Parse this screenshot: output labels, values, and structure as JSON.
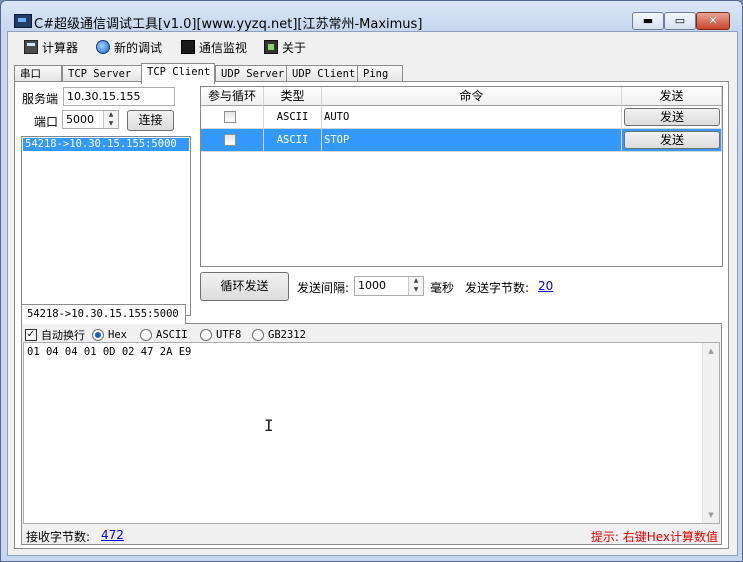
{
  "window": {
    "title": "C#超级通信调试工具[v1.0][www.yyzq.net][江苏常州-Maximus]",
    "minimize_label": "▬",
    "maximize_label": "▭",
    "close_label": "✕"
  },
  "menu": {
    "items": [
      {
        "label": "计算器",
        "icon": "calculator-icon"
      },
      {
        "label": "新的调试",
        "icon": "globe-icon"
      },
      {
        "label": "通信监视",
        "icon": "monitor-icon"
      },
      {
        "label": "关于",
        "icon": "about-icon"
      }
    ]
  },
  "tabs": [
    {
      "label": "串口"
    },
    {
      "label": "TCP Server"
    },
    {
      "label": "TCP Client",
      "active": true
    },
    {
      "label": "UDP Server"
    },
    {
      "label": "UDP Client"
    },
    {
      "label": "Ping"
    }
  ],
  "connection": {
    "server_label": "服务端",
    "server_value": "10.30.15.155",
    "port_label": "端口",
    "port_value": "5000",
    "connect_button": "连接",
    "connections": [
      "54218->10.30.15.155:5000"
    ]
  },
  "commands": {
    "headers": [
      "参与循环",
      "类型",
      "命令",
      "发送"
    ],
    "rows": [
      {
        "loop": false,
        "type": "ASCII",
        "command": "AUTO",
        "send": "发送",
        "selected": false
      },
      {
        "loop": false,
        "type": "ASCII",
        "command": "STOP",
        "send": "发送",
        "selected": true
      }
    ]
  },
  "send_controls": {
    "loop_button": "循环发送",
    "interval_label": "发送间隔:",
    "interval_value": "1000",
    "interval_unit": "毫秒",
    "bytes_label": "发送字节数:",
    "bytes_value": "20"
  },
  "receive": {
    "tab_label": "54218->10.30.15.155:5000",
    "auto_wrap_label": "自动换行",
    "auto_wrap_checked": true,
    "formats": [
      "Hex",
      "ASCII",
      "UTF8",
      "GB2312"
    ],
    "selected_format": "Hex",
    "content": "01 04 04 01 0D 02 47 2A E9",
    "bytes_label": "接收字节数:",
    "bytes_value": "472",
    "hint": "提示: 右键Hex计算数值",
    "hint_color": "#e00000"
  },
  "colors": {
    "selection": "#3399ff",
    "link": "#0000ee"
  }
}
